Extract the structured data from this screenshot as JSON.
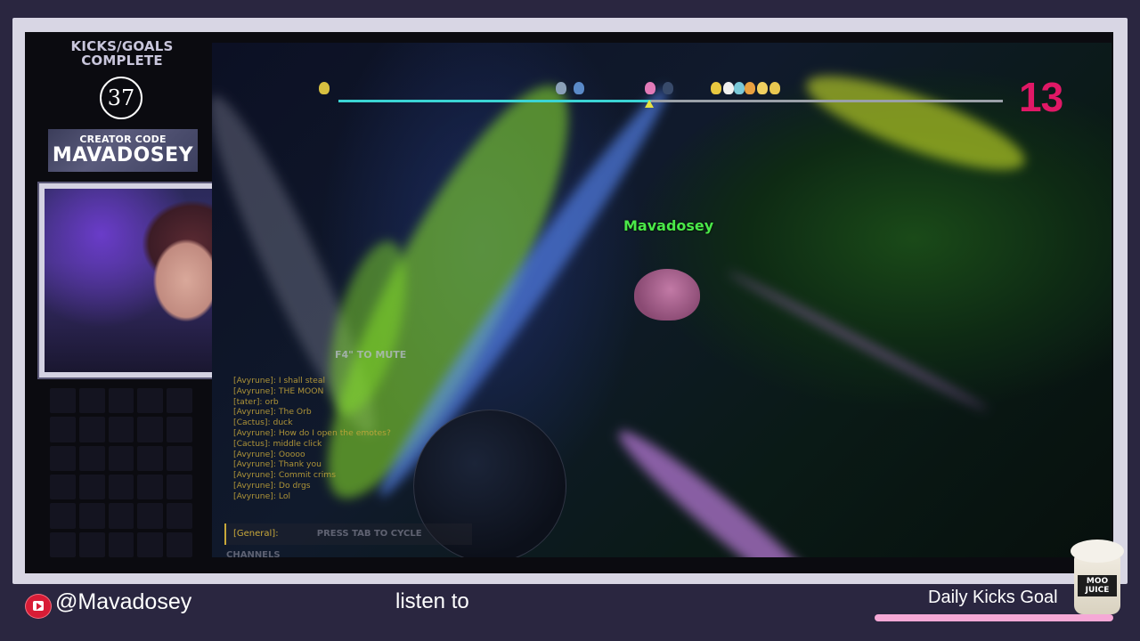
{
  "sidebar": {
    "goals_title": "KICKS/GOALS COMPLETE",
    "goals_count": "37",
    "creator_code_label": "CREATOR CODE",
    "creator_code_value": "MAVADOSEY"
  },
  "game": {
    "player_name": "Mavadosey",
    "place_number": "13",
    "race_progress_fraction": 0.47,
    "mute_hint": "F4\" TO MUTE",
    "chat": [
      "[Avyrune]: I shall steal",
      "[Avyrune]: THE MOON",
      "[tater]: orb",
      "[Avyrune]: The Orb",
      "[Cactus]: duck",
      "[Avyrune]: How do I open the emotes?",
      "[Cactus]: middle click",
      "[Avyrune]: Ooooo",
      "[Avyrune]: Thank you",
      "[Avyrune]: Commit crims",
      "[Avyrune]: Do drgs",
      "[Avyrune]: Lol"
    ],
    "chat_channel": "[General]:",
    "chat_hint": "PRESS TAB TO CYCLE CHANNELS"
  },
  "footer": {
    "handle": "@Mavadosey",
    "ticker_text": "listen to",
    "daily_goal_label": "Daily Kicks Goal",
    "sponsor_logo_text": "MOO JUICE"
  },
  "colors": {
    "place_number": "#e01866",
    "player_name": "#4ae84a",
    "progress_fill": "#3bd4d4",
    "daily_bar": "#f5a8d6",
    "youtube": "#d81c36"
  },
  "icons": {
    "youtube": "youtube-icon",
    "sponsor": "moo-juice-logo"
  }
}
